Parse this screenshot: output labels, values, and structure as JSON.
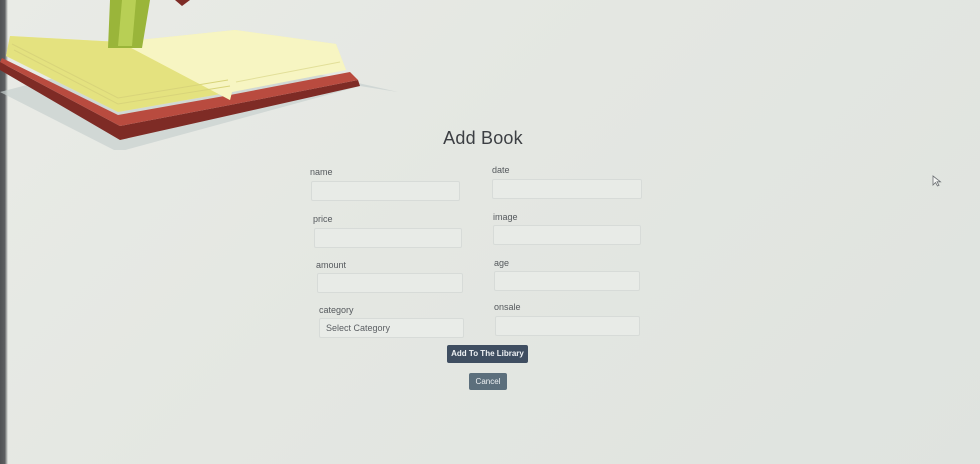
{
  "page": {
    "title": "Add Book"
  },
  "form": {
    "name_label": "name",
    "date_label": "date",
    "price_label": "price",
    "image_label": "image",
    "amount_label": "amount",
    "age_label": "age",
    "category_label": "category",
    "onsale_label": "onsale",
    "name_value": "",
    "date_value": "",
    "price_value": "",
    "image_value": "",
    "amount_value": "",
    "age_value": "",
    "onsale_value": "",
    "category_selected": "Select Category"
  },
  "actions": {
    "add_label": "Add To The Library",
    "cancel_label": "Cancel"
  },
  "colors": {
    "primary_button": "#3f4e61",
    "secondary_button": "#5c6f7c"
  },
  "icons": {
    "header_art": "open-book-icon",
    "pointer": "mouse-cursor-icon"
  }
}
